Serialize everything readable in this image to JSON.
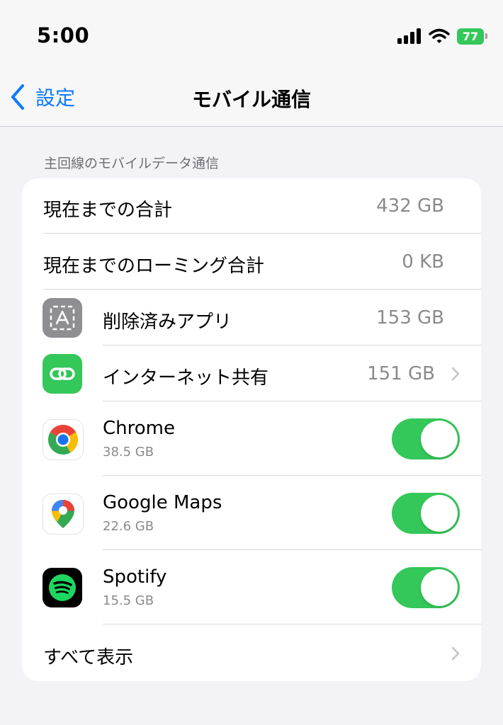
{
  "status_bar": {
    "time": "5:00",
    "battery": "77"
  },
  "nav": {
    "back_label": "設定",
    "title": "モバイル通信"
  },
  "section_header": "主回線のモバイルデータ通信",
  "rows": [
    {
      "label": "現在までの合計",
      "value": "432 GB"
    },
    {
      "label": "現在までのローミング合計",
      "value": "0 KB"
    },
    {
      "label": "削除済みアプリ",
      "value": "153 GB",
      "icon": "app-store-icon"
    },
    {
      "label": "インターネット共有",
      "value": "151 GB",
      "icon": "hotspot-chain-icon"
    }
  ],
  "apps": [
    {
      "name": "Chrome",
      "usage": "38.5 GB",
      "enabled": true,
      "icon": "chrome-icon"
    },
    {
      "name": "Google Maps",
      "usage": "22.6 GB",
      "enabled": true,
      "icon": "google-maps-icon"
    },
    {
      "name": "Spotify",
      "usage": "15.5 GB",
      "enabled": true,
      "icon": "spotify-icon"
    }
  ],
  "show_all_label": "すべて表示",
  "colors": {
    "accent": "#0a7aff",
    "toggle_on": "#34c759",
    "battery": "#34c759",
    "spotify": "#1ed760"
  }
}
